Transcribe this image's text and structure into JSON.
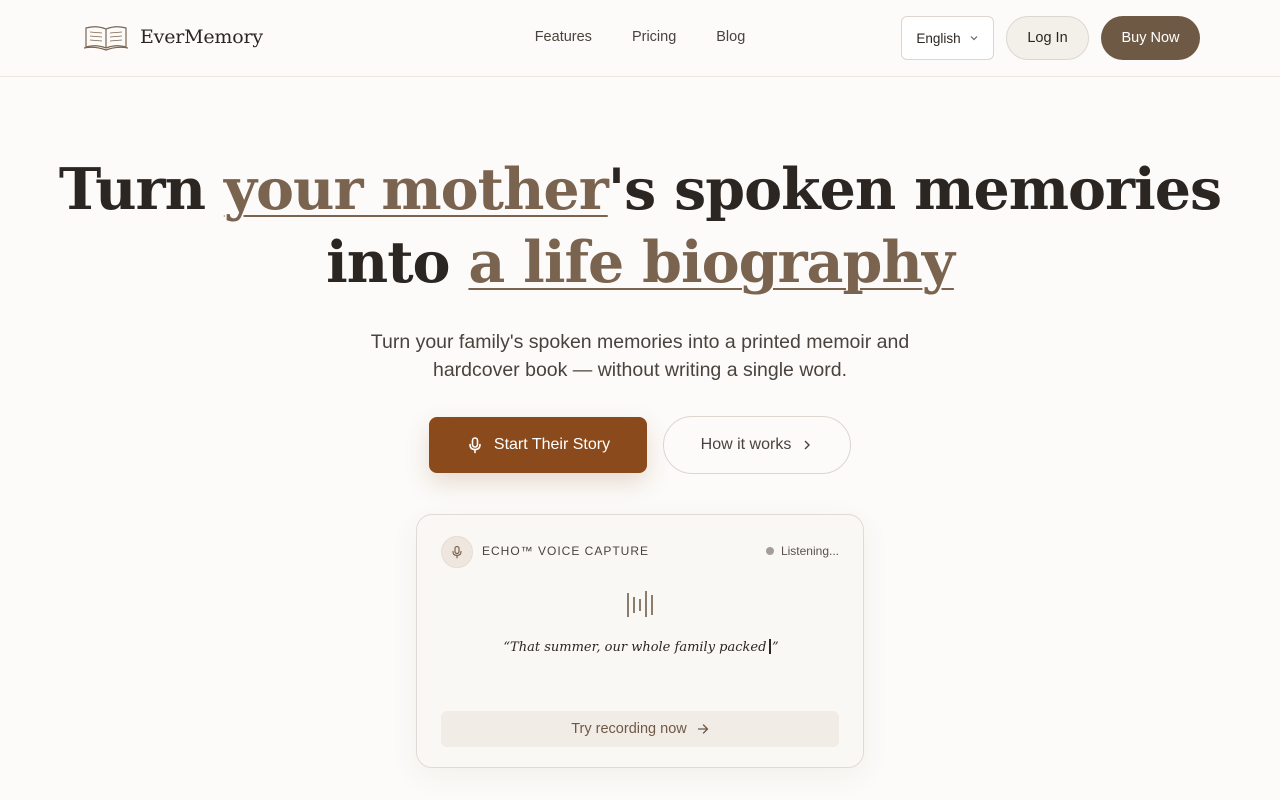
{
  "brand": {
    "name": "EverMemory",
    "logo_icon": "open-book-icon"
  },
  "nav": {
    "links": [
      "Features",
      "Pricing",
      "Blog"
    ]
  },
  "header": {
    "language": "English",
    "login_label": "Log In",
    "buy_label": "Buy Now"
  },
  "hero": {
    "title_part1": "Turn ",
    "title_hl1": "your mother",
    "title_part2": "'s spoken memories",
    "title_part3": "into ",
    "title_hl2": "a life biography",
    "subtitle_line1": "Turn your family's spoken memories into a printed memoir and",
    "subtitle_line2": "hardcover book — without writing a single word.",
    "cta_primary": "Start Their Story",
    "cta_secondary": "How it works"
  },
  "echo_card": {
    "label": "ECHO™ VOICE CAPTURE",
    "status": "Listening...",
    "quote_text": "“That summer, our whole family packed",
    "quote_close": "”",
    "try_label": "Try recording now"
  },
  "colors": {
    "accent": "#8a4a1c",
    "brand_brown": "#6e5a44",
    "highlight": "#7a6450",
    "background": "#fcfbf9"
  }
}
